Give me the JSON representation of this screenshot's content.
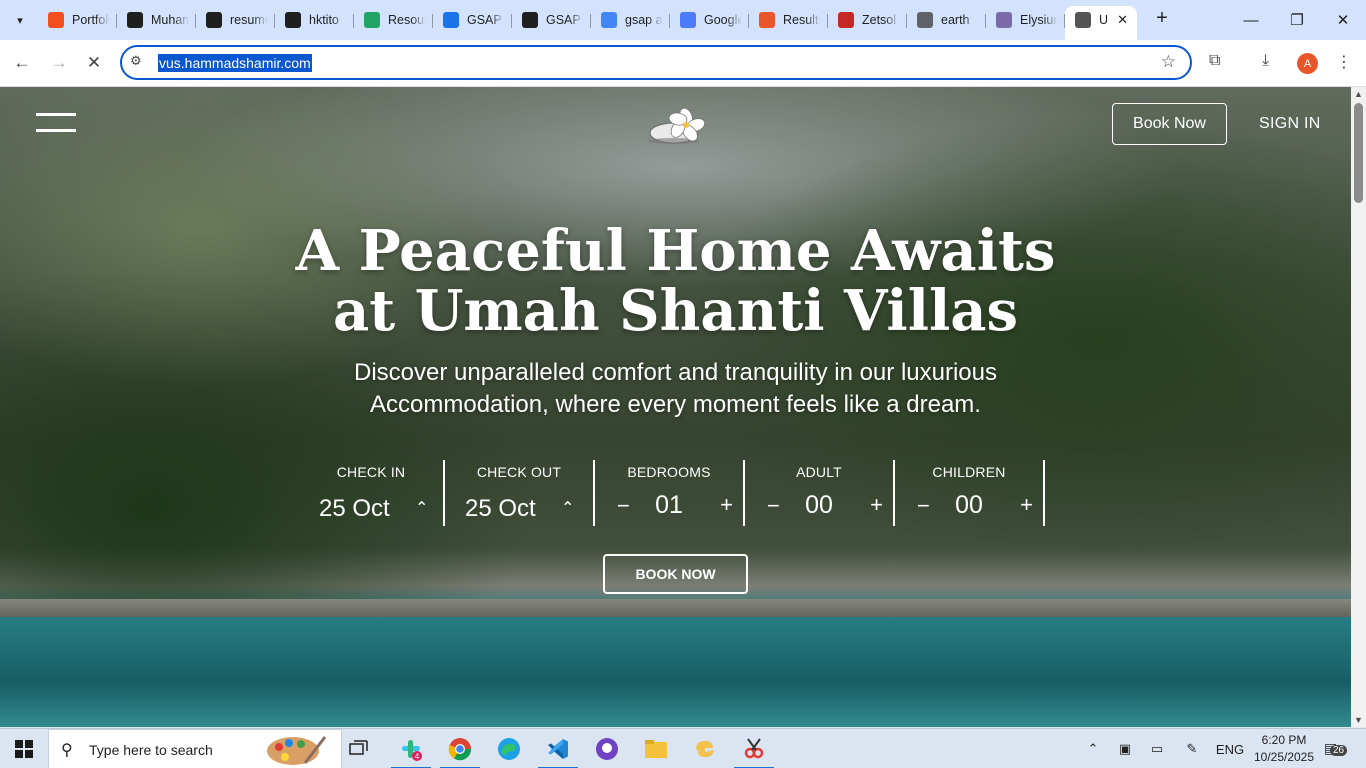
{
  "browser": {
    "tabs": [
      {
        "label": "Portfolio",
        "icon": "figma-icon",
        "color": "#f24e1e"
      },
      {
        "label": "Muhammad",
        "icon": "openai-icon",
        "color": "#1f1f1f"
      },
      {
        "label": "resume",
        "icon": "openai-icon",
        "color": "#1f1f1f"
      },
      {
        "label": "hktito",
        "icon": "github-icon",
        "color": "#1f1f1f"
      },
      {
        "label": "Resources",
        "icon": "puzzle-icon",
        "color": "#21a366"
      },
      {
        "label": "GSAP",
        "icon": "bolt-icon",
        "color": "#1a73e8"
      },
      {
        "label": "GSAP",
        "icon": "codepen-icon",
        "color": "#1f1f1f"
      },
      {
        "label": "gsap a",
        "icon": "google-icon",
        "color": "#4285f4"
      },
      {
        "label": "Google",
        "icon": "gemini-icon",
        "color": "#4a7cf7"
      },
      {
        "label": "Results",
        "icon": "results-icon",
        "color": "#e8562a"
      },
      {
        "label": "Zetsol",
        "icon": "zetsol-icon",
        "color": "#c62828"
      },
      {
        "label": "earth",
        "icon": "globe-icon",
        "color": "#5f6368"
      },
      {
        "label": "Elysium",
        "icon": "elysium-icon",
        "color": "#7a6aa8"
      },
      {
        "label": "U",
        "icon": "site-icon",
        "color": "#555555",
        "active": true
      }
    ],
    "url": "vus.hammadshamir.com",
    "profile_initial": "A"
  },
  "page": {
    "nav": {
      "book_now": "Book Now",
      "sign_in": "SIGN IN"
    },
    "hero": {
      "title_line1": "A Peaceful Home Awaits",
      "title_line2": "at Umah Shanti Villas",
      "subtitle_line1": "Discover unparalleled comfort and tranquility in our luxurious",
      "subtitle_line2": "Accommodation, where every moment feels like a dream."
    },
    "booking": {
      "check_in": {
        "label": "CHECK IN",
        "value": "25 Oct"
      },
      "check_out": {
        "label": "CHECK OUT",
        "value": "25 Oct"
      },
      "bedrooms": {
        "label": "BEDROOMS",
        "value": "01"
      },
      "adult": {
        "label": "ADULT",
        "value": "00"
      },
      "children": {
        "label": "CHILDREN",
        "value": "00"
      },
      "submit": "BOOK NOW"
    }
  },
  "taskbar": {
    "search_placeholder": "Type here to search",
    "language": "ENG",
    "time": "6:20 PM",
    "date": "10/25/2025",
    "notification_count": "26",
    "app_badge": "4"
  }
}
